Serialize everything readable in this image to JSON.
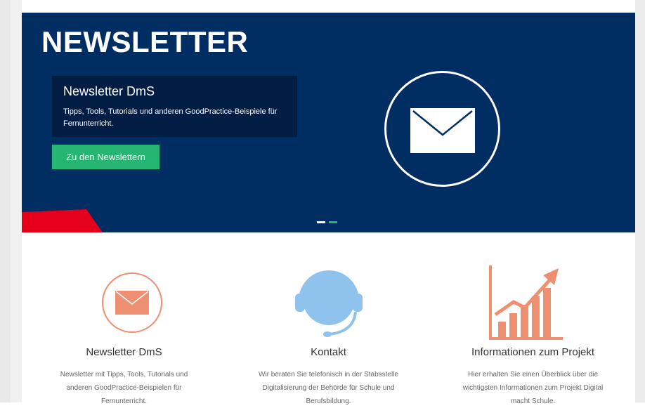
{
  "hero": {
    "heading": "NEWSLETTER",
    "caption_title": "Newsletter DmS",
    "caption_text_line1": "Tipps, Tools, Tutorials und anderen GoodPractice-Beispiele für",
    "caption_text_line2": "Fernunterricht.",
    "button_label": "Zu den Newslettern",
    "colors": {
      "background": "#002d62",
      "caption_box": "#021d44",
      "button": "#27b574",
      "accent_red": "#e4001b"
    },
    "icon": "envelope-icon",
    "slides": [
      {
        "state": "inactive"
      },
      {
        "state": "active"
      }
    ]
  },
  "features": [
    {
      "icon": "envelope-icon",
      "title": "Newsletter DmS",
      "line1": "Newsletter mit Tipps, Tools, Tutorials und",
      "line2": "anderen GoodPractice-Beispielen für",
      "line3": "Fernunterricht."
    },
    {
      "icon": "headset-icon",
      "title": "Kontakt",
      "line1": "Wir beraten Sie telefonisch in der Stabsstelle",
      "line2": "Digitalisierung der Behörde für Schule und",
      "line3": "Berufsbildung."
    },
    {
      "icon": "growth-chart-icon",
      "title": "Informationen zum Projekt",
      "line1": "Hier erhalten Sie einen Überblick über die",
      "line2": "wichtigsten Informationen zum Projekt Digital",
      "line3": "macht Schule."
    }
  ],
  "colors": {
    "icon_salmon": "#ef8f72",
    "icon_light_blue": "#8fc3ee",
    "title_text": "#333333",
    "body_text": "#666666"
  }
}
